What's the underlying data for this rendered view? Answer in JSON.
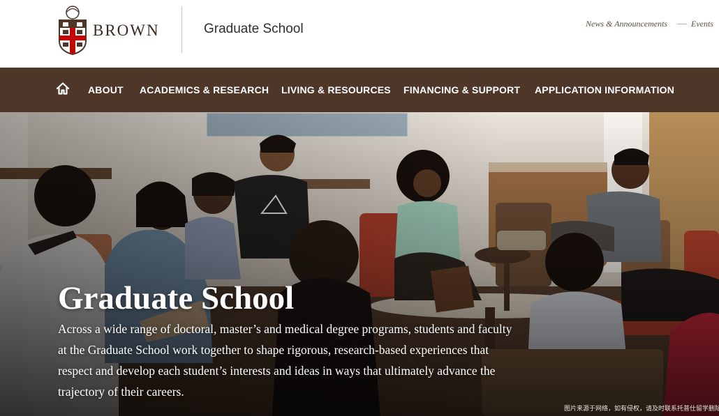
{
  "header": {
    "brand": "BROWN",
    "school_name": "Graduate School",
    "utility_links": [
      "News & Announcements",
      "Events"
    ]
  },
  "nav": {
    "home_icon": "home-icon",
    "items": [
      "ABOUT",
      "ACADEMICS & RESEARCH",
      "LIVING & RESOURCES",
      "FINANCING & SUPPORT",
      "APPLICATION INFORMATION"
    ]
  },
  "hero": {
    "title": "Graduate School",
    "description": "Across a wide range of doctoral, master’s and medical degree programs, students and faculty at the Graduate School work together to shape rigorous, research-based experiences that respect and develop each student’s interests and ideas in ways that ultimately advance the trajectory of their careers.",
    "watermark": "图片来源于网络，如有侵权，请及时联系托普仕留学删除"
  },
  "colors": {
    "nav_background": "#4e3629",
    "brand_red": "#c00404",
    "brand_brown": "#4e3629"
  }
}
